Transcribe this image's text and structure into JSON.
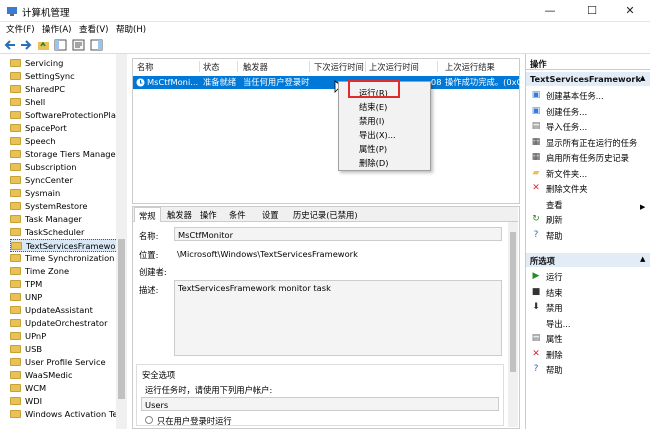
{
  "window": {
    "title": "计算机管理",
    "min": "—",
    "max": "☐",
    "close": "✕"
  },
  "menu": [
    "文件(F)",
    "操作(A)",
    "查看(V)",
    "帮助(H)"
  ],
  "tree": [
    "Servicing",
    "SettingSync",
    "SharedPC",
    "Shell",
    "SoftwareProtectionPlat",
    "SpacePort",
    "Speech",
    "Storage Tiers Manager",
    "Subscription",
    "SyncCenter",
    "Sysmain",
    "SystemRestore",
    "Task Manager",
    "TaskScheduler",
    "TextServicesFramework",
    "Time Synchronization",
    "Time Zone",
    "TPM",
    "UNP",
    "UpdateAssistant",
    "UpdateOrchestrator",
    "UPnP",
    "USB",
    "User Profile Service",
    "WaaSMedic",
    "WCM",
    "WDI",
    "Windows Activation Te"
  ],
  "columns": [
    "名称",
    "状态",
    "触发器",
    "下次运行时间",
    "上次运行时间",
    "上次运行结果"
  ],
  "task": {
    "name": "MsCtfMoni...",
    "status": "准备就绪",
    "trigger": "当任何用户登录时",
    "last_run": "...08",
    "result": "操作成功完成。(0xC"
  },
  "context_menu": [
    "运行(R)",
    "结束(E)",
    "禁用(I)",
    "导出(X)...",
    "属性(P)",
    "删除(D)"
  ],
  "tabs": [
    "常规",
    "触发器",
    "操作",
    "条件",
    "设置",
    "历史记录(已禁用)"
  ],
  "general": {
    "name_label": "名称:",
    "name_value": "MsCtfMonitor",
    "location_label": "位置:",
    "location_value": "\\Microsoft\\Windows\\TextServicesFramework",
    "author_label": "创建者:",
    "desc_label": "描述:",
    "desc_value": "TextServicesFramework monitor task",
    "security_title": "安全选项",
    "run_as_label": "运行任务时，请使用下列用户帐户:",
    "user_value": "Users",
    "radio_label": "只在用户登录时运行"
  },
  "actions": {
    "header": "操作",
    "section1": "TextServicesFramework",
    "items1": [
      "创建基本任务...",
      "创建任务...",
      "导入任务...",
      "显示所有正在运行的任务",
      "启用所有任务历史记录",
      "新文件夹...",
      "删除文件夹",
      "查看",
      "刷新",
      "帮助"
    ],
    "section2": "所选项",
    "items2": [
      "运行",
      "结束",
      "禁用",
      "导出...",
      "属性",
      "删除",
      "帮助"
    ],
    "submenu_arrow": "▶",
    "collapse_arrow": "▲"
  }
}
